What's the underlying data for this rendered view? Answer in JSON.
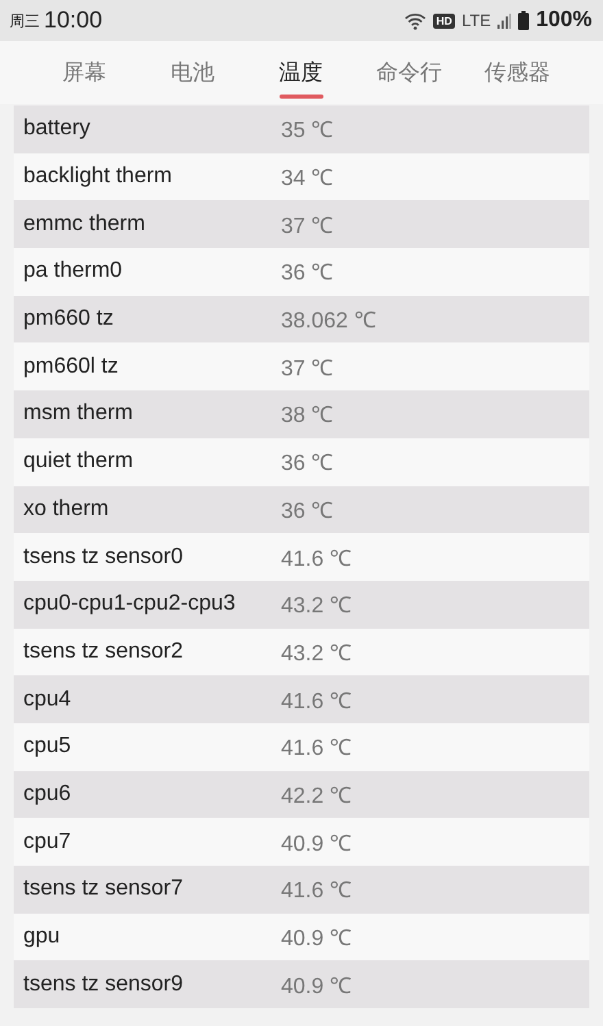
{
  "status_bar": {
    "day": "周三",
    "time": "10:00",
    "hd_badge": "HD",
    "network": "LTE",
    "battery": "100%"
  },
  "tabs": [
    {
      "label": "屏幕",
      "selected": false
    },
    {
      "label": "电池",
      "selected": false
    },
    {
      "label": "温度",
      "selected": true
    },
    {
      "label": "命令行",
      "selected": false
    },
    {
      "label": "传感器",
      "selected": false
    }
  ],
  "table": {
    "rows": [
      {
        "name": "battery",
        "value": "35 ℃"
      },
      {
        "name": "backlight therm",
        "value": "34 ℃"
      },
      {
        "name": "emmc therm",
        "value": "37 ℃"
      },
      {
        "name": "pa therm0",
        "value": "36 ℃"
      },
      {
        "name": "pm660 tz",
        "value": "38.062 ℃"
      },
      {
        "name": "pm660l tz",
        "value": "37 ℃"
      },
      {
        "name": "msm therm",
        "value": "38 ℃"
      },
      {
        "name": "quiet therm",
        "value": "36 ℃"
      },
      {
        "name": "xo therm",
        "value": "36 ℃"
      },
      {
        "name": "tsens tz sensor0",
        "value": "41.6 ℃"
      },
      {
        "name": "cpu0-cpu1-cpu2-cpu3",
        "value": "43.2 ℃"
      },
      {
        "name": "tsens tz sensor2",
        "value": "43.2 ℃"
      },
      {
        "name": "cpu4",
        "value": "41.6 ℃"
      },
      {
        "name": "cpu5",
        "value": "41.6 ℃"
      },
      {
        "name": "cpu6",
        "value": "42.2 ℃"
      },
      {
        "name": "cpu7",
        "value": "40.9 ℃"
      },
      {
        "name": "tsens tz sensor7",
        "value": "41.6 ℃"
      },
      {
        "name": "gpu",
        "value": "40.9 ℃"
      },
      {
        "name": "tsens tz sensor9",
        "value": "40.9 ℃"
      }
    ]
  }
}
